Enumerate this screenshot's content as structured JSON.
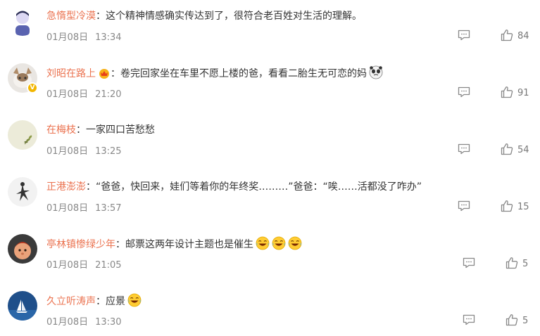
{
  "comments": [
    {
      "user": "急惰型冷漠",
      "text": "这个精神情感确实传达到了，很符合老百姓对生活的理解。",
      "date": "01月08日",
      "time": "13:34",
      "likes": "84"
    },
    {
      "user": "刘昭在路上",
      "text": "卷完回家坐在车里不愿上楼的爸，看看二胎生无可恋的妈",
      "date": "01月08日",
      "time": "21:20",
      "likes": "91",
      "verified_badge": "V"
    },
    {
      "user": "在梅枝",
      "text": "一家四口苦愁愁",
      "date": "01月08日",
      "time": "13:25",
      "likes": "54"
    },
    {
      "user": "正港澎澎",
      "text": "“爸爸，快回来，娃们等着你的年终奖………”爸爸：“唉……活都没了咋办”",
      "date": "01月08日",
      "time": "13:57",
      "likes": "15"
    },
    {
      "user": "亭林镇惨绿少年",
      "text": "邮票这两年设计主题也是催生",
      "date": "01月08日",
      "time": "21:05",
      "likes": "5"
    },
    {
      "user": "久立听涛声",
      "text": "应景",
      "date": "01月08日",
      "time": "13:30",
      "likes": "5"
    }
  ],
  "separator": "：",
  "icons": {
    "reply": "comment-icon",
    "like": "thumbs-up-icon"
  },
  "colors": {
    "username": "#eb7350",
    "meta": "#888888",
    "badge": "#f2b600"
  }
}
